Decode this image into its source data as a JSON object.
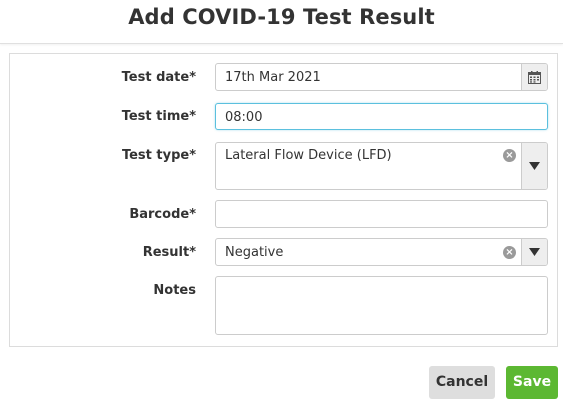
{
  "dialog": {
    "title": "Add COVID-19 Test Result"
  },
  "form": {
    "test_date": {
      "label": "Test date*",
      "value": "17th Mar 2021",
      "icon": "calendar-icon"
    },
    "test_time": {
      "label": "Test time*",
      "value": "08:00"
    },
    "test_type": {
      "label": "Test type*",
      "value": "Lateral Flow Device (LFD)",
      "icons": [
        "clear-icon",
        "caret-down-icon"
      ]
    },
    "barcode": {
      "label": "Barcode*",
      "value": ""
    },
    "result": {
      "label": "Result*",
      "value": "Negative",
      "icons": [
        "clear-icon",
        "caret-down-icon"
      ]
    },
    "notes": {
      "label": "Notes",
      "value": ""
    }
  },
  "actions": {
    "cancel_label": "Cancel",
    "save_label": "Save"
  },
  "colors": {
    "save": "#5cb832",
    "cancel": "#dedede",
    "focus_border": "#5bc0de"
  }
}
